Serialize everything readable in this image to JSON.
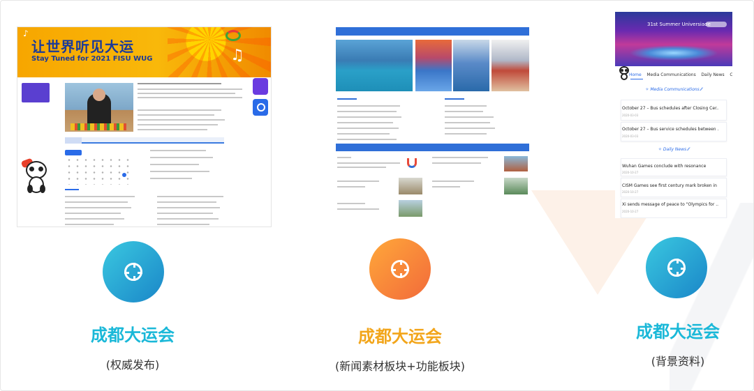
{
  "shot_left": {
    "title": "让世界听见大运",
    "subtitle": "Stay Tuned for 2021 FISU WUG"
  },
  "shot_right": {
    "hero_text": "31st Summer Universiade",
    "tabs": [
      "Home",
      "Media Communications",
      "Daily News",
      "C"
    ],
    "media_section": "Media Communications",
    "media_items": [
      {
        "title": "October 27 – Bus schedules after Closing Cer...",
        "date": "2020-03-03"
      },
      {
        "title": "October 27 – Bus service schedules between ...",
        "date": "2020-03-03"
      }
    ],
    "news_section": "Daily News",
    "news_items": [
      {
        "title": "Wuhan Games conclude with resonance",
        "date": "2020-10-27"
      },
      {
        "title": "CISM Games see first century mark broken in ...",
        "date": "2020-10-27"
      },
      {
        "title": "Xi sends message of peace to \"Olympics for ...",
        "date": "2020-10-27"
      }
    ]
  },
  "captions": [
    {
      "title": "成都大运会",
      "sub": "(权威发布)",
      "color": "#1ab8d8"
    },
    {
      "title": "成都大运会",
      "sub": "(新闻素材板块+功能板块)",
      "color": "#f2a51a"
    },
    {
      "title": "成都大运会",
      "sub": "(背景资料)",
      "color": "#1ab8d8"
    }
  ]
}
